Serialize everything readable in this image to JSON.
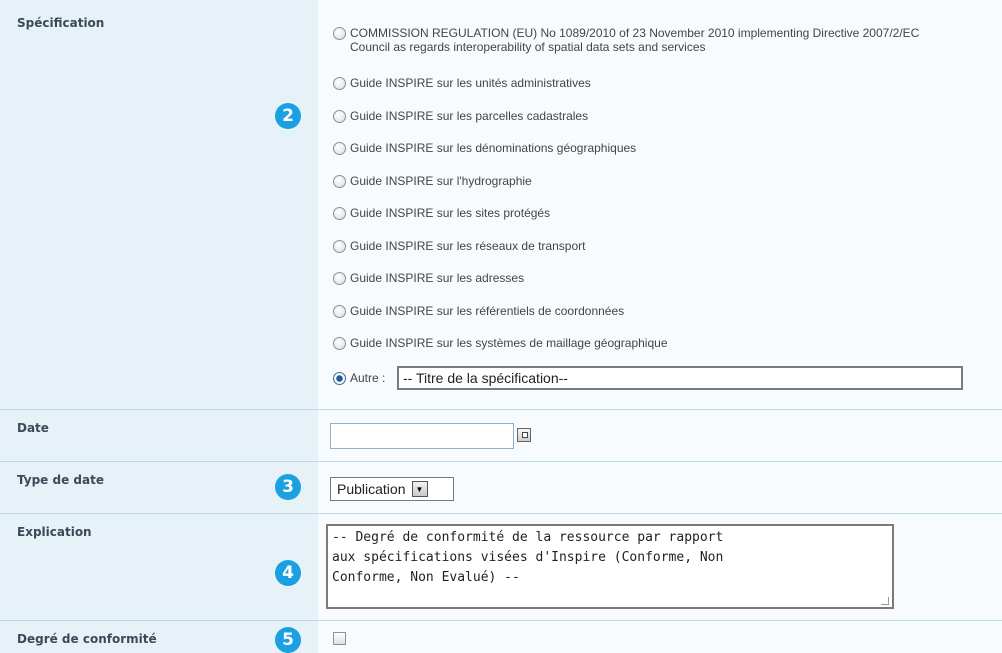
{
  "specification": {
    "label": "Spécification",
    "badge": "2",
    "options": [
      {
        "line1": "COMMISSION REGULATION (EU) No 1089/2010 of 23 November 2010 implementing Directive 2007/2/EC",
        "line2": "Council as regards interoperability of spatial data sets and services",
        "checked": false
      },
      {
        "line1": "Guide INSPIRE sur les unités administratives",
        "checked": false
      },
      {
        "line1": "Guide INSPIRE sur les parcelles cadastrales",
        "checked": false
      },
      {
        "line1": "Guide INSPIRE sur les dénominations géographiques",
        "checked": false
      },
      {
        "line1": "Guide INSPIRE sur l'hydrographie",
        "checked": false
      },
      {
        "line1": "Guide INSPIRE sur les sites protégés",
        "checked": false
      },
      {
        "line1": "Guide INSPIRE sur les réseaux de transport",
        "checked": false
      },
      {
        "line1": "Guide INSPIRE sur les adresses",
        "checked": false
      },
      {
        "line1": "Guide INSPIRE sur les référentiels de coordonnées",
        "checked": false
      },
      {
        "line1": "Guide INSPIRE sur les systèmes de maillage géographique",
        "checked": false
      }
    ],
    "other_label": "Autre :",
    "other_checked": true,
    "other_value": "-- Titre de la spécification--"
  },
  "date": {
    "label": "Date",
    "value": ""
  },
  "date_type": {
    "label": "Type de date",
    "badge": "3",
    "selected": "Publication"
  },
  "explanation": {
    "label": "Explication",
    "badge": "4",
    "value": "-- Degré de conformité de la ressource par rapport\naux spécifications visées d'Inspire (Conforme, Non\nConforme, Non Evalué) --"
  },
  "conformity": {
    "label": "Degré de conformité",
    "badge": "5",
    "checked": false
  }
}
